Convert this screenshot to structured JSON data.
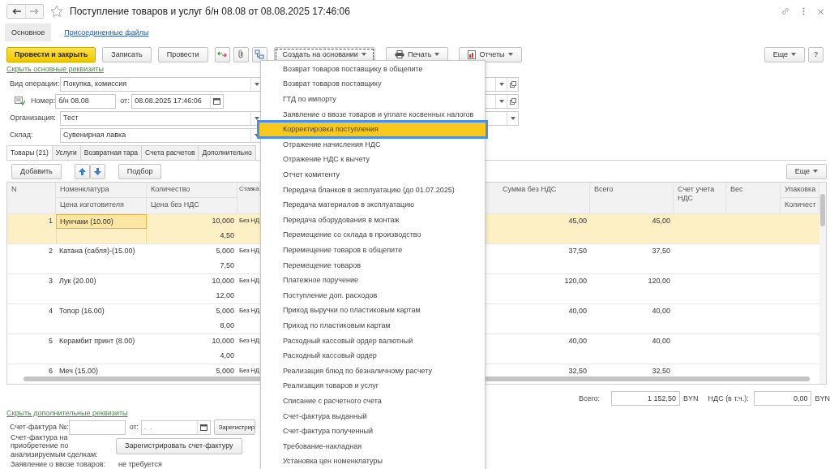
{
  "window": {
    "title": "Поступление товаров и услуг б/н 08.08 от 08.08.2025 17:46:06"
  },
  "form_tabs": [
    {
      "label": "Основное",
      "selected": true
    },
    {
      "label": "Присоединенные файлы",
      "selected": false
    }
  ],
  "toolbar": {
    "commands": [
      {
        "kind": "primary",
        "label": "Провести и закрыть"
      },
      {
        "kind": "plain",
        "label": "Записать"
      },
      {
        "kind": "plain",
        "label": "Провести"
      }
    ],
    "menus": [
      {
        "label": "Создать на основании",
        "expanded": true
      },
      {
        "label": "Печать",
        "expanded": false
      },
      {
        "label": "Отчеты",
        "expanded": false
      }
    ],
    "more": "Еще",
    "help": "?"
  },
  "main_details": {
    "toggle_link": "Скрыть основные реквизиты",
    "operation": {
      "label": "Вид операции:",
      "value": "Покупка, комиссия"
    },
    "number": {
      "label": "Номер:",
      "value": "б/н 08.08",
      "date_label": "от:",
      "date_value": "08.08.2025 17:46:06"
    },
    "organization": {
      "label": "Организация:",
      "value": "Тест"
    },
    "warehouse": {
      "label": "Склад:",
      "value": "Сувенирная лавка"
    }
  },
  "table_tabs": [
    {
      "label": "Товары (21)",
      "selected": true
    },
    {
      "label": "Услуги",
      "selected": false
    },
    {
      "label": "Возвратная тара",
      "selected": false
    },
    {
      "label": "Счета расчетов",
      "selected": false
    },
    {
      "label": "Дополнительно",
      "selected": false
    }
  ],
  "table_toolbar": {
    "add": "Добавить",
    "pick": "Подбор",
    "more": "Еще"
  },
  "table": {
    "columns": [
      {
        "top": "N"
      },
      {
        "top": "Номенклатура",
        "bottom": "Цена изготовителя"
      },
      {
        "top": "Количество",
        "bottom": "Цена без НДС"
      },
      {
        "top": "Ставка"
      },
      {
        "top": "Сумма без НДС"
      },
      {
        "top": "Всего"
      },
      {
        "top": "Счет учета НДС"
      },
      {
        "top": "Вес"
      },
      {
        "top": "Упаковка",
        "bottom": "Количест"
      }
    ],
    "rows": [
      {
        "n": "1",
        "item": "Нунчаки (10.00)",
        "qty": "10,000",
        "price": "4,50",
        "rate": "Без НД",
        "sum": "45,00",
        "total": "45,00",
        "selected": true
      },
      {
        "n": "2",
        "item": "Катана (сабля)-(15.00)",
        "qty": "5,000",
        "price": "7,50",
        "rate": "Без НД",
        "sum": "37,50",
        "total": "37,50",
        "selected": false
      },
      {
        "n": "3",
        "item": "Лук (20.00)",
        "qty": "10,000",
        "price": "12,00",
        "rate": "Без НД",
        "sum": "120,00",
        "total": "120,00",
        "selected": false
      },
      {
        "n": "4",
        "item": "Топор (16.00)",
        "qty": "5,000",
        "price": "8,00",
        "rate": "Без НД",
        "sum": "40,00",
        "total": "40,00",
        "selected": false
      },
      {
        "n": "5",
        "item": "Керамбит принт (8.00)",
        "qty": "10,000",
        "price": "4,00",
        "rate": "Без НД",
        "sum": "40,00",
        "total": "40,00",
        "selected": false
      },
      {
        "n": "6",
        "item": "Меч (15.00)",
        "qty": "5,000",
        "rate": "Без НД",
        "sum": "32,50",
        "total": "32,50",
        "selected": false
      }
    ]
  },
  "totals": {
    "total_label": "Всего:",
    "total": "1 152,50",
    "currency": "BYN",
    "vat_label": "НДС (в т.ч.):",
    "vat": "0,00",
    "vat_currency": "BYN"
  },
  "extra_details": {
    "toggle_link": "Скрыть дополнительные реквизиты",
    "invoice_label": "Счет-фактура №:",
    "date_label": "от:",
    "date_value": ".  .",
    "register_button": "Зарегистрир",
    "purchase_label": "Счет-фактура на приобретение по анализируемым сделкам:",
    "purchase_button": "Зарегистрировать счет-фактуру",
    "import_label": "Заявление о ввозе товаров:",
    "import_value": "не требуется"
  },
  "create_menu": {
    "items": [
      {
        "label": "Возврат товаров поставщику в общепите",
        "selected": false
      },
      {
        "label": "Возврат товаров поставщику",
        "selected": false
      },
      {
        "label": "ГТД по импорту",
        "selected": false
      },
      {
        "label": "Заявление о ввозе товаров и уплате косвенных налогов",
        "selected": false
      },
      {
        "label": "Корректировка поступления",
        "selected": true
      },
      {
        "label": "Отражение начисления НДС",
        "selected": false
      },
      {
        "label": "Отражение НДС к вычету",
        "selected": false
      },
      {
        "label": "Отчет комитенту",
        "selected": false
      },
      {
        "label": "Передача бланков в эксплуатацию (до 01.07.2025)",
        "selected": false
      },
      {
        "label": "Передача материалов в эксплуатацию",
        "selected": false
      },
      {
        "label": "Передача оборудования в монтаж",
        "selected": false
      },
      {
        "label": "Перемещение со склада в производство",
        "selected": false
      },
      {
        "label": "Перемещение товаров в общепите",
        "selected": false
      },
      {
        "label": "Перемещение товаров",
        "selected": false
      },
      {
        "label": "Платежное поручение",
        "selected": false
      },
      {
        "label": "Поступление доп. расходов",
        "selected": false
      },
      {
        "label": "Приход выручки по пластиковым картам",
        "selected": false
      },
      {
        "label": "Приход по пластиковым картам",
        "selected": false
      },
      {
        "label": "Расходный кассовый ордер валютный",
        "selected": false
      },
      {
        "label": "Расходный кассовый ордер",
        "selected": false
      },
      {
        "label": "Реализация блюд по безналичному расчету",
        "selected": false
      },
      {
        "label": "Реализация товаров и услуг",
        "selected": false
      },
      {
        "label": "Списание с расчетного счета",
        "selected": false
      },
      {
        "label": "Счет-фактура выданный",
        "selected": false
      },
      {
        "label": "Счет-фактура полученный",
        "selected": false
      },
      {
        "label": "Требование-накладная",
        "selected": false
      },
      {
        "label": "Установка цен номенклатуры",
        "selected": false
      }
    ]
  }
}
